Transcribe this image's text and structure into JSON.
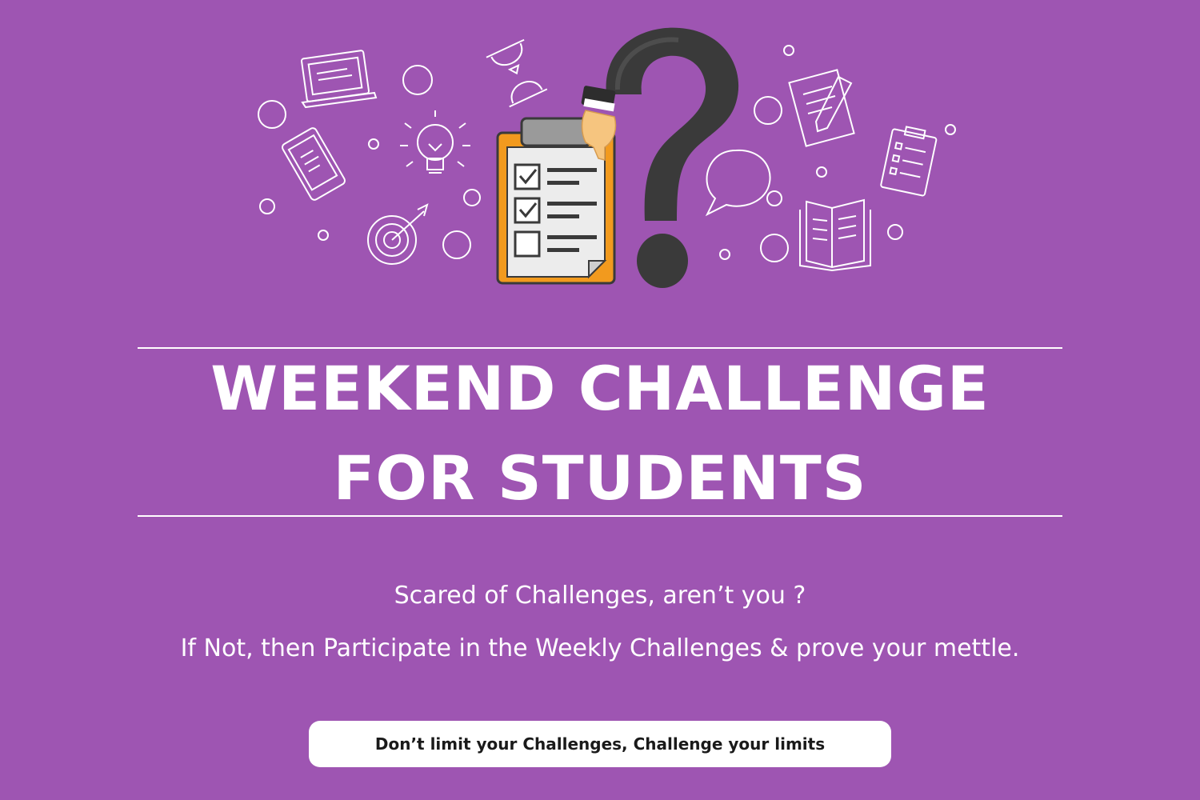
{
  "colors": {
    "background": "#9e55b2",
    "line_art": "#ffffff",
    "clipboard_frame": "#f29a1e",
    "question_mark": "#3a3a3a"
  },
  "icons": [
    "laptop-icon",
    "hourglass-icon",
    "tablet-icon",
    "lightbulb-icon",
    "target-icon",
    "clipboard-checklist-icon",
    "question-mark-icon",
    "hand-icon",
    "document-pencil-icon",
    "speech-bubble-icon",
    "clipboard-list-icon",
    "open-book-icon"
  ],
  "headline": {
    "line1": "WEEKEND CHALLENGE",
    "line2": "FOR STUDENTS"
  },
  "taglines": {
    "line1": "Scared of Challenges, aren’t you ?",
    "line2": "If Not, then Participate in the Weekly Challenges & prove your mettle."
  },
  "slogan": "Don’t limit your Challenges, Challenge your limits"
}
